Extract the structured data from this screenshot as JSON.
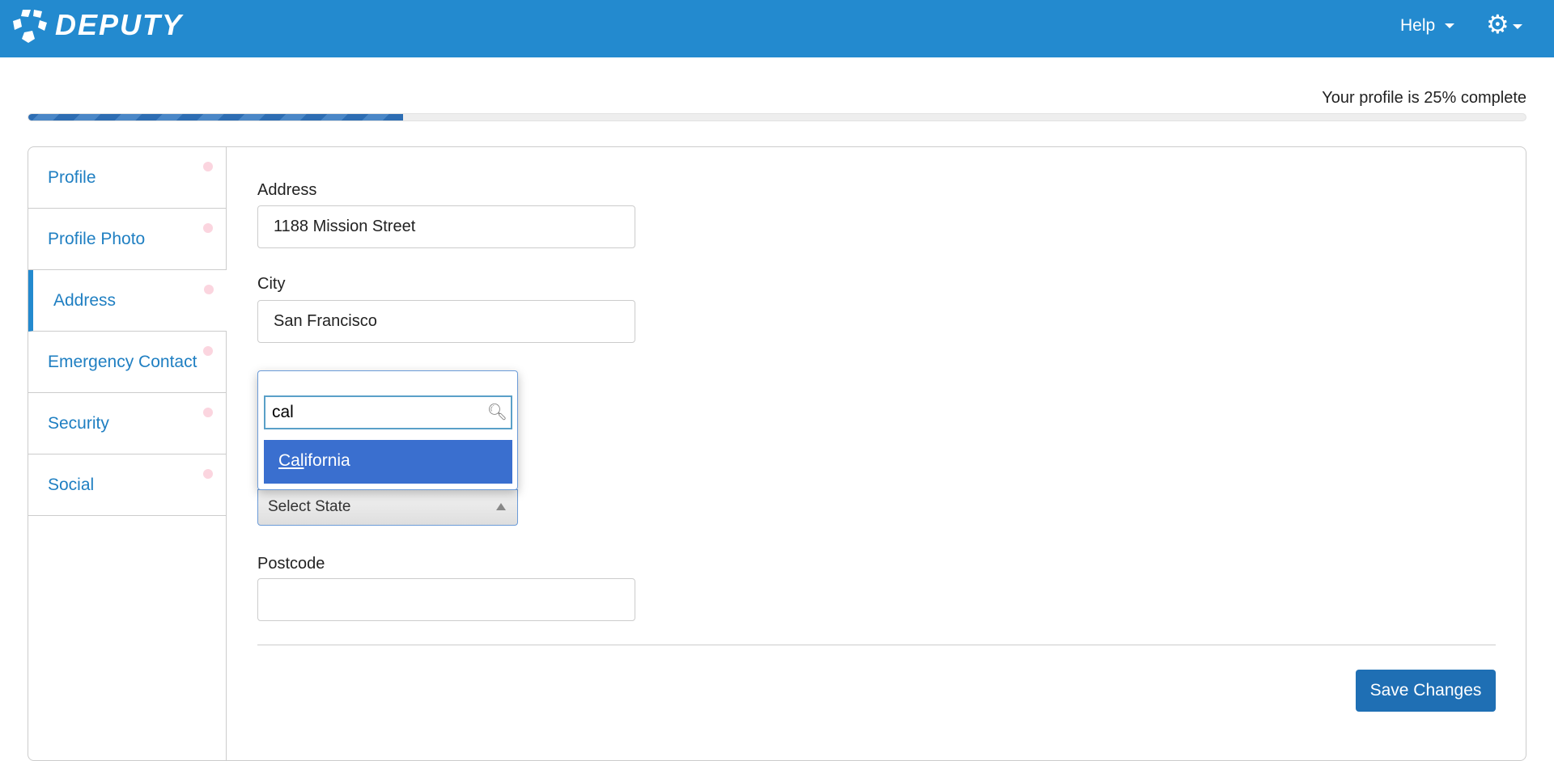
{
  "header": {
    "brand": "DEPUTY",
    "help_label": "Help",
    "settings_icon": "gear-icon"
  },
  "progress": {
    "text": "Your profile is 25% complete",
    "percent": 25
  },
  "sidebar": {
    "items": [
      {
        "label": "Profile",
        "active": false
      },
      {
        "label": "Profile Photo",
        "active": false
      },
      {
        "label": "Address",
        "active": true
      },
      {
        "label": "Emergency Contact",
        "active": false
      },
      {
        "label": "Security",
        "active": false
      },
      {
        "label": "Social",
        "active": false
      }
    ]
  },
  "form": {
    "address_label": "Address",
    "address_value": "1188 Mission Street",
    "city_label": "City",
    "city_value": "San Francisco",
    "state_placeholder": "Select State",
    "state_search": "cal",
    "state_option_match": "Cal",
    "state_option_rest": "ifornia",
    "postcode_label": "Postcode",
    "postcode_value": "",
    "save_label": "Save Changes"
  },
  "colors": {
    "header": "#238acf",
    "accent": "#1f6fb4",
    "highlight": "#3a6fcf"
  }
}
